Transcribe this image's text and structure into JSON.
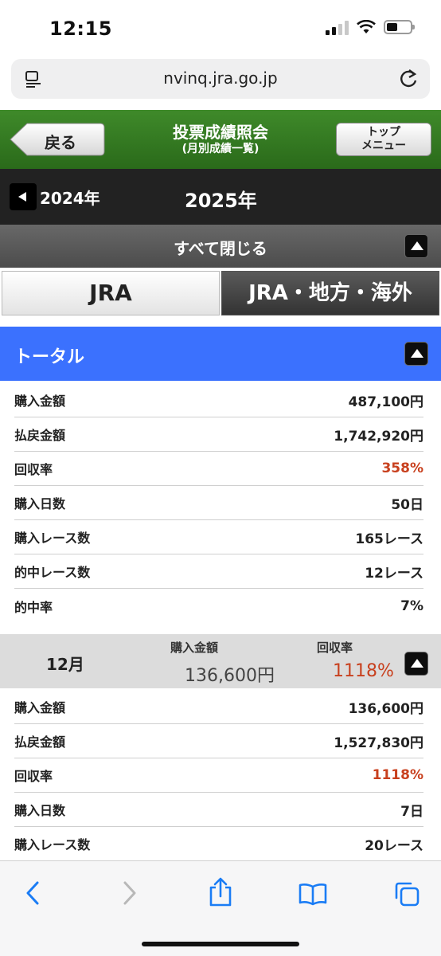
{
  "status_bar": {
    "time": "12:15"
  },
  "browser": {
    "url": "nvinq.jra.go.jp"
  },
  "header": {
    "back_label": "戻る",
    "title": "投票成績照会",
    "subtitle": "(月別成績一覧)",
    "top_menu_line1": "トップ",
    "top_menu_line2": "メニュー"
  },
  "year_nav": {
    "prev_year": "2024年",
    "current_year": "2025年"
  },
  "close_all_label": "すべて閉じる",
  "tabs": {
    "jra": "JRA",
    "all": "JRA・地方・海外"
  },
  "total": {
    "label": "トータル",
    "rows": [
      {
        "label": "購入金額",
        "value": "487,100円"
      },
      {
        "label": "払戻金額",
        "value": "1,742,920円"
      },
      {
        "label": "回収率",
        "value": "358%"
      },
      {
        "label": "購入日数",
        "value": "50日"
      },
      {
        "label": "購入レース数",
        "value": "165レース"
      },
      {
        "label": "的中レース数",
        "value": "12レース"
      },
      {
        "label": "的中率",
        "value": "7%"
      }
    ]
  },
  "month": {
    "label": "12月",
    "purchase_header": "購入金額",
    "return_header": "回収率",
    "purchase_value": "136,600円",
    "return_value": "1118%",
    "rows": [
      {
        "label": "購入金額",
        "value": "136,600円"
      },
      {
        "label": "払戻金額",
        "value": "1,527,830円"
      },
      {
        "label": "回収率",
        "value": "1118%"
      },
      {
        "label": "購入日数",
        "value": "7日"
      },
      {
        "label": "購入レース数",
        "value": "20レース"
      }
    ]
  },
  "colors": {
    "accent_red": "#c8401e",
    "total_blue": "#3b71fe",
    "header_green": "#2f7a1e",
    "ios_blue": "#1a7cf5"
  },
  "toolbar_icons": [
    "chevron-left-icon",
    "chevron-right-icon",
    "share-icon",
    "bookmarks-icon",
    "tabs-icon"
  ]
}
